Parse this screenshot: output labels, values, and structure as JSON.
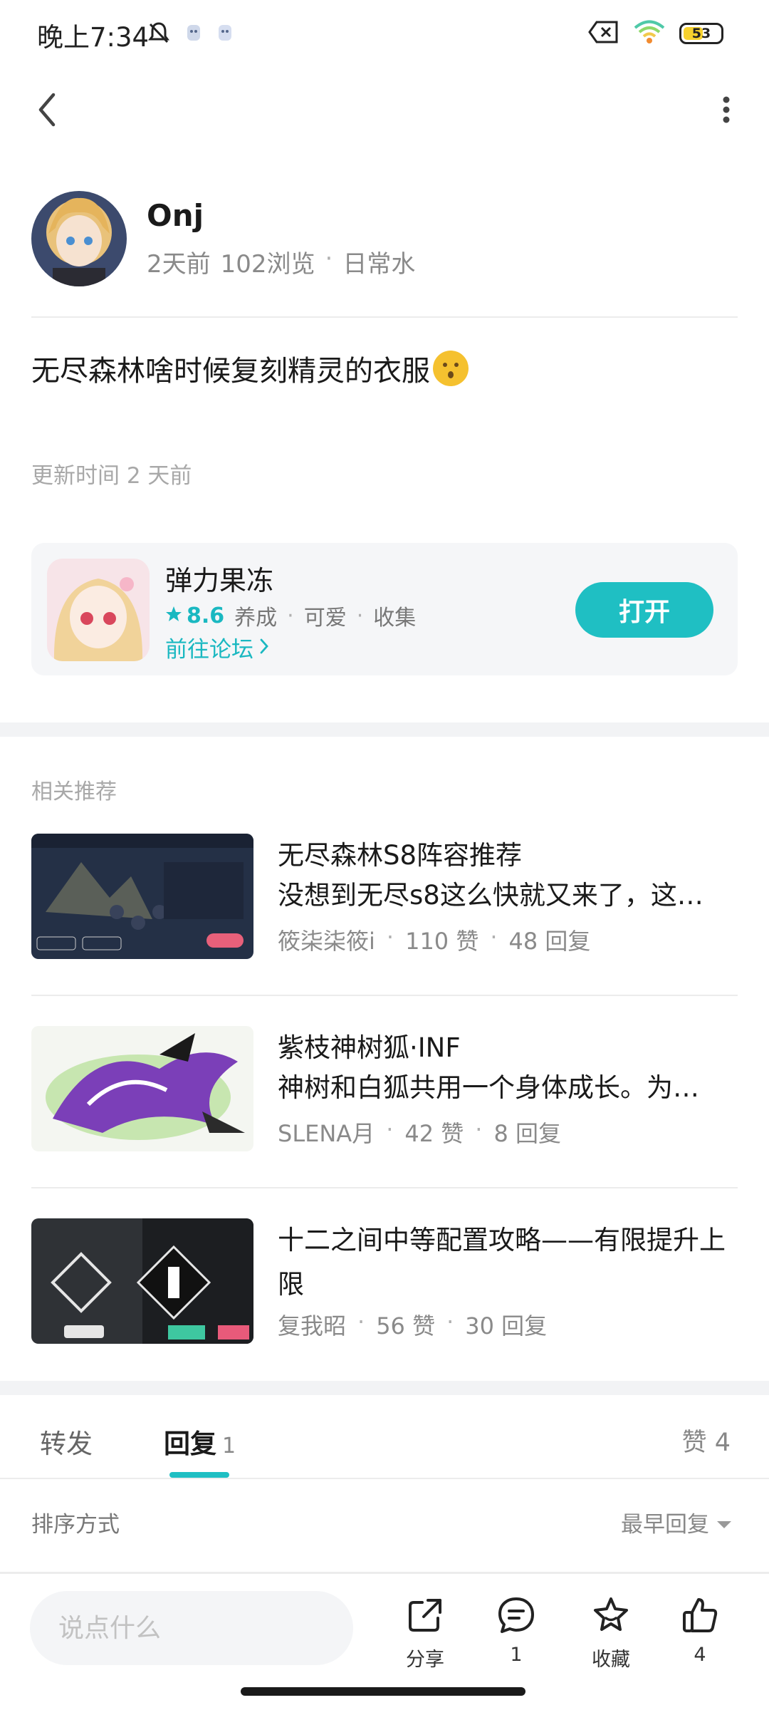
{
  "status_bar": {
    "time": "晚上7:34",
    "battery_level": "53",
    "battery_percent": 53
  },
  "nav": {
    "back_icon": "chevron-left-icon",
    "more_icon": "more-vertical-icon"
  },
  "author": {
    "name": "Onj",
    "time_ago": "2天前",
    "views": "102浏览",
    "separator": "·",
    "category": "日常水"
  },
  "post": {
    "text": "无尽森林啥时候复刻精灵的衣服",
    "emoji": "kissing-face-emoji",
    "update_time": "更新时间 2 天前"
  },
  "app_card": {
    "name": "弹力果冻",
    "score": "8.6",
    "tags": [
      "养成",
      "可爱",
      "收集"
    ],
    "separator": "·",
    "forum_link": "前往论坛",
    "open_button": "打开"
  },
  "related": {
    "label": "相关推荐",
    "items": [
      {
        "title": "无尽森林S8阵容推荐",
        "desc": "没想到无尽s8这么快就又来了，这…",
        "author": "筱柒柒筱i",
        "likes": "110 赞",
        "replies": "48 回复"
      },
      {
        "title": "紫枝神树狐·INF",
        "desc": "神树和白狐共用一个身体成长。为…",
        "author": "SLENA月",
        "likes": "42 赞",
        "replies": "8 回复"
      },
      {
        "title": "十二之间中等配置攻略——有限提升上限",
        "desc": "",
        "author": "复我昭",
        "likes": "56 赞",
        "replies": "30 回复"
      }
    ]
  },
  "tabs": {
    "repost": "转发",
    "reply": "回复",
    "reply_count": "1",
    "like": "赞 4"
  },
  "sort": {
    "label": "排序方式",
    "value": "最早回复"
  },
  "bottom_bar": {
    "input_placeholder": "说点什么",
    "share_label": "分享",
    "comment_count": "1",
    "favorite_label": "收藏",
    "like_count": "4"
  },
  "colors": {
    "accent": "#1fbfc3",
    "text_primary": "#1a1a1a",
    "text_secondary": "#8a8a8a"
  }
}
